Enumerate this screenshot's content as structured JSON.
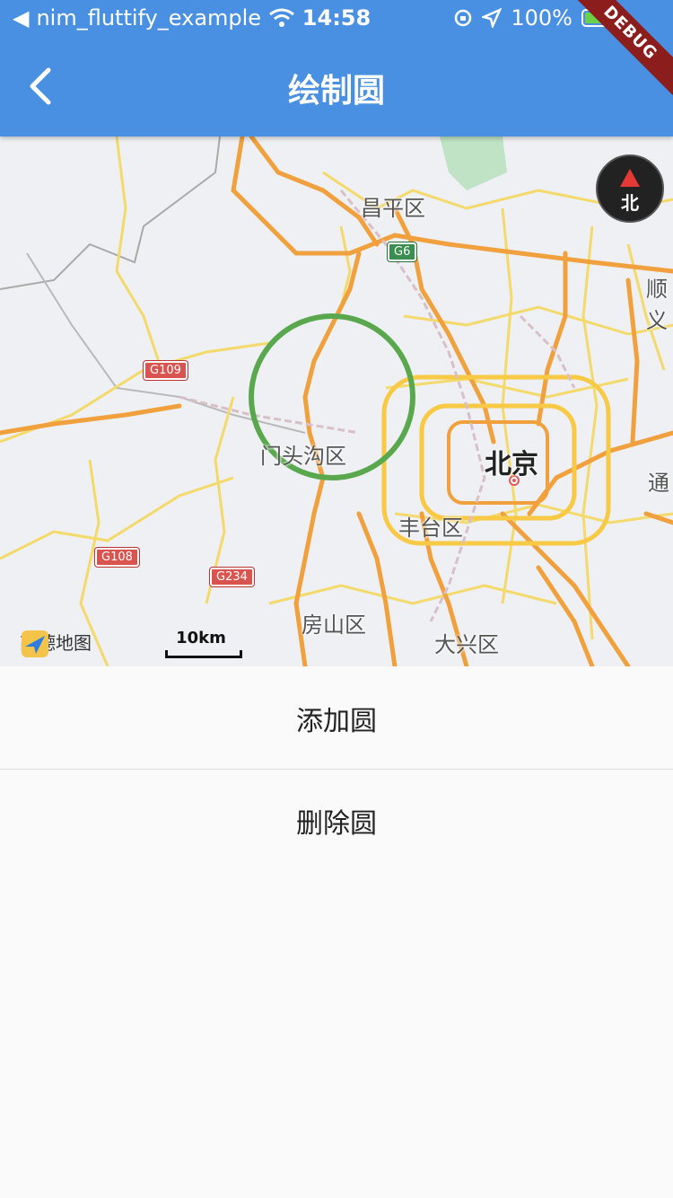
{
  "status_bar": {
    "back_app": "nim_fluttify_example",
    "time": "14:58",
    "battery": "100%"
  },
  "app_bar": {
    "title": "绘制圆"
  },
  "debug_banner": "DEBUG",
  "map": {
    "labels": {
      "changping": "昌平区",
      "shunyi": "顺义",
      "mentougou": "门头沟区",
      "beijing": "北京",
      "tongzhou": "通",
      "fengtai": "丰台区",
      "fangshan": "房山区",
      "daxing": "大兴区"
    },
    "shields": {
      "g6": "G6",
      "g109": "G109",
      "g108": "G108",
      "g234": "G234"
    },
    "compass_label": "北",
    "logo_text": "高德地图",
    "scale_label": "10km"
  },
  "actions": {
    "add_circle": "添加圆",
    "remove_circle": "删除圆"
  },
  "colors": {
    "app_bar": "#4a90e2",
    "circle_stroke": "#5aa84e"
  },
  "icons": [
    "back-arrow-icon",
    "wifi-icon",
    "location-icon",
    "battery-icon",
    "compass-icon",
    "amap-logo-icon"
  ]
}
